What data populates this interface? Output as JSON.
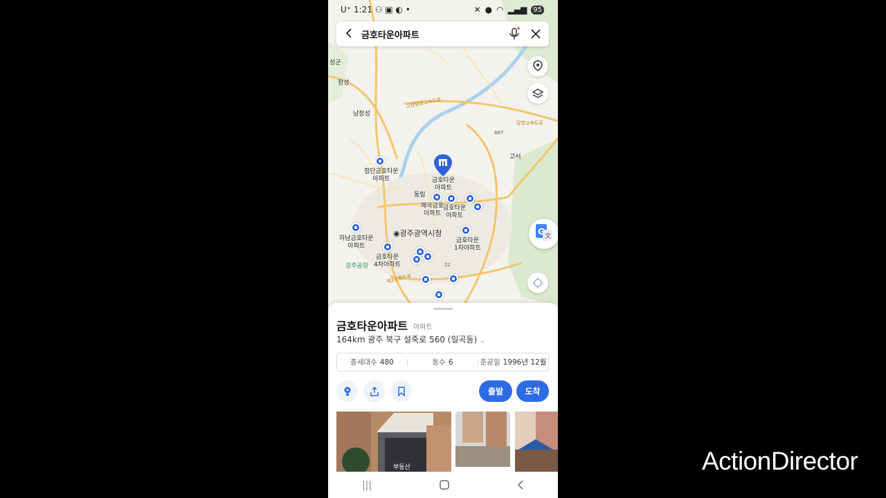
{
  "status": {
    "time": "1:21",
    "carrier": "U⁺",
    "battery": "95"
  },
  "search": {
    "query": "금호타운아파트"
  },
  "map": {
    "region_labels": {
      "left_edge": "성군",
      "jangseong": "장성",
      "namjangseong": "남장성",
      "goseo": "고서",
      "dongrim": "동림",
      "gwangju_airport": "광주공항"
    },
    "road_labels": {
      "expressway_1": "고창담양고속도로",
      "expressway_2": "담양고속도로",
      "route_887": "887",
      "route_22": "22",
      "ring_road": "제2순환도로"
    },
    "city_hall": "광주광역시청",
    "main_pin_label": [
      "금호타운",
      "아파트"
    ],
    "pin_labels": [
      {
        "name": "cheomdan",
        "text": [
          "첨단금호타운",
          "아파트"
        ]
      },
      {
        "name": "maegok",
        "text": [
          "매곡금호",
          "아파트"
        ]
      },
      {
        "name": "geumho-extra",
        "text": [
          "금호타운",
          "아파트"
        ]
      },
      {
        "name": "hanam",
        "text": [
          "하남금호타운",
          "아파트"
        ]
      },
      {
        "name": "fourth",
        "text": [
          "금호타운",
          "4차아파트"
        ]
      },
      {
        "name": "first",
        "text": [
          "금호타운",
          "1차아파트"
        ]
      }
    ]
  },
  "place": {
    "title": "금호타운아파트",
    "category": "아파트",
    "address": "164km 광주 북구 설죽로 560 (일곡동)",
    "stats": [
      {
        "label": "총세대수",
        "value": "480"
      },
      {
        "label": "동수",
        "value": "6"
      },
      {
        "label": "준공일",
        "value": "1996년 12월"
      }
    ],
    "depart_label": "출발",
    "arrive_label": "도착",
    "photo_caption": "부동산"
  },
  "watermark": "ActionDirector",
  "colors": {
    "accent": "#2d6be4",
    "pin": "#2d63d8",
    "road": "#f5c56b"
  }
}
